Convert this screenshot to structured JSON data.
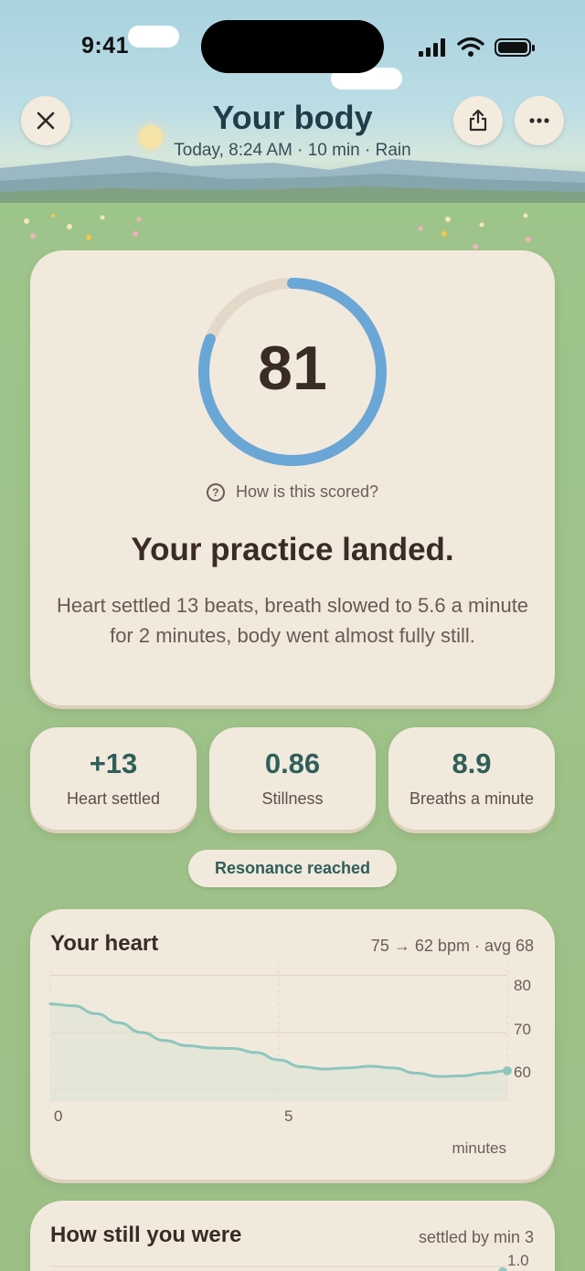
{
  "status_bar": {
    "time": "9:41"
  },
  "header": {
    "title": "Your body",
    "subtitle": "Today, 8:24 AM · 10 min · Rain",
    "close_icon": "close-icon",
    "share_icon": "share-icon",
    "more_icon": "more-icon"
  },
  "score": {
    "value": "81",
    "fraction": 0.81,
    "how_scored": "How is this scored?",
    "headline": "Your practice landed.",
    "summary": "Heart settled 13 beats, breath slowed to 5.6 a minute for 2 minutes, body went almost fully still."
  },
  "stats": [
    {
      "value": "+13",
      "label": "Heart settled"
    },
    {
      "value": "0.86",
      "label": "Stillness"
    },
    {
      "value": "8.9",
      "label": "Breaths a minute"
    }
  ],
  "badge": "Resonance reached",
  "heart": {
    "title": "Your heart",
    "meta": "75 → 62 bpm · avg 68",
    "x_unit": "minutes"
  },
  "stillness": {
    "title": "How still you were",
    "meta": "settled by min 3",
    "first_tick": "1.0"
  },
  "colors": {
    "accent_blue": "#6aa6d6",
    "teal": "#2e5f5a",
    "line": "#8cc7bd",
    "card": "#f2e9dd"
  },
  "chart_data": {
    "type": "line",
    "title": "Your heart",
    "xlabel": "minutes",
    "ylabel": "",
    "x_ticks": [
      "0",
      "5"
    ],
    "y_ticks": [
      "80",
      "70",
      "60"
    ],
    "xlim": [
      0,
      10
    ],
    "ylim": [
      58,
      82
    ],
    "grid": true,
    "series": [
      {
        "x": [
          0,
          0.5,
          1,
          1.5,
          2,
          2.5,
          3,
          3.5,
          4,
          4.5,
          5,
          5.5,
          6,
          6.5,
          7,
          7.5,
          8,
          8.5,
          9,
          9.5,
          10
        ],
        "y": [
          75,
          74.7,
          73.3,
          71.7,
          70,
          68.6,
          67.7,
          67.3,
          67.2,
          66.5,
          65.2,
          64,
          63.6,
          63.8,
          64.1,
          63.8,
          62.9,
          62.3,
          62.4,
          62.9,
          63.3
        ]
      }
    ]
  }
}
